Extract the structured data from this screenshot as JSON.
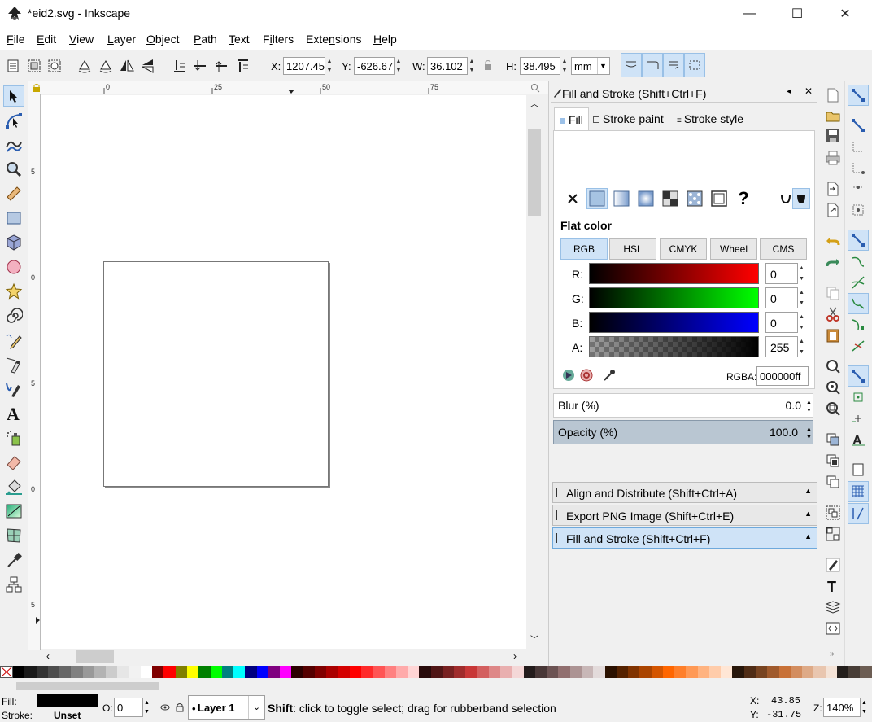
{
  "window": {
    "title": "*eid2.svg - Inkscape",
    "minimize_glyph": "—",
    "maximize_glyph": "☐",
    "close_glyph": "✕"
  },
  "menu": [
    {
      "label": "File",
      "key": "F",
      "rest": "ile"
    },
    {
      "label": "Edit",
      "key": "E",
      "rest": "dit"
    },
    {
      "label": "View",
      "key": "V",
      "rest": "iew"
    },
    {
      "label": "Layer",
      "key": "L",
      "rest": "ayer"
    },
    {
      "label": "Object",
      "key": "O",
      "rest": "bject"
    },
    {
      "label": "Path",
      "key": "P",
      "rest": "ath"
    },
    {
      "label": "Text",
      "key": "T",
      "rest": "ext"
    },
    {
      "label": "Filters",
      "key": "i",
      "pre": "F",
      "rest": "lters"
    },
    {
      "label": "Extensions",
      "key": "n",
      "pre": "Exte",
      "rest": "sions"
    },
    {
      "label": "Help",
      "key": "H",
      "rest": "elp"
    }
  ],
  "tool_controls": {
    "x_label": "X:",
    "x_value": "1207.45",
    "y_label": "Y:",
    "y_value": "-626.67",
    "w_label": "W:",
    "w_value": "36.102",
    "h_label": "H:",
    "h_value": "38.495",
    "unit": "mm"
  },
  "rulers": {
    "top_ticks": [
      "0",
      "25",
      "50",
      "75"
    ],
    "left_ticks": [
      "5",
      "0",
      "5",
      "0",
      "5",
      "0",
      "5"
    ]
  },
  "fill_stroke": {
    "title": "Fill and Stroke (Shift+Ctrl+F)",
    "tabs": {
      "fill": "Fill",
      "stroke_paint": "Stroke paint",
      "stroke_style": "Stroke style"
    },
    "unknown_paint": "?",
    "flat_color_heading": "Flat color",
    "modes": [
      "RGB",
      "HSL",
      "CMYK",
      "Wheel",
      "CMS"
    ],
    "channels": {
      "r_label": "R:",
      "r_value": "0",
      "g_label": "G:",
      "g_value": "0",
      "b_label": "B:",
      "b_value": "0",
      "a_label": "A:",
      "a_value": "255"
    },
    "rgba_label": "RGBA:",
    "rgba_value": "000000ff",
    "blur_label": "Blur (%)",
    "blur_value": "0.0",
    "opacity_label": "Opacity (%)",
    "opacity_value": "100.0"
  },
  "docked_dialogs": [
    "Align and Distribute (Shift+Ctrl+A)",
    "Export PNG Image (Shift+Ctrl+E)",
    "Fill and Stroke (Shift+Ctrl+F)"
  ],
  "palette": [
    "#000000",
    "#1a1a1a",
    "#333333",
    "#4d4d4d",
    "#666666",
    "#808080",
    "#999999",
    "#b3b3b3",
    "#cccccc",
    "#e6e6e6",
    "#f2f2f2",
    "#ffffff",
    "#800000",
    "#ff0000",
    "#808000",
    "#ffff00",
    "#008000",
    "#00ff00",
    "#008080",
    "#00ffff",
    "#000080",
    "#0000ff",
    "#800080",
    "#ff00ff",
    "#2b0000",
    "#550000",
    "#800000",
    "#aa0000",
    "#d40000",
    "#ff0000",
    "#ff2a2a",
    "#ff5555",
    "#ff8080",
    "#ffaaaa",
    "#ffd5d5",
    "#280b0b",
    "#501616",
    "#782121",
    "#a02c2c",
    "#c83737",
    "#d35f5f",
    "#de8787",
    "#e9afaf",
    "#f4d7d7",
    "#241c1c",
    "#483737",
    "#6c5353",
    "#916f6f",
    "#ac9393",
    "#c8b7b7",
    "#e3dbdb",
    "#2b1100",
    "#552200",
    "#803300",
    "#aa4400",
    "#d45500",
    "#ff6600",
    "#ff7f2a",
    "#ff9955",
    "#ffb380",
    "#ffccaa",
    "#ffe6d5",
    "#28170b",
    "#502d16",
    "#784421",
    "#a05a2c",
    "#c87137",
    "#d38d5f",
    "#deaa87",
    "#e9c6af",
    "#f4e3d7",
    "#241f1c",
    "#483e37",
    "#6c5d53"
  ],
  "status": {
    "fill_label": "Fill:",
    "stroke_label": "Stroke:",
    "stroke_value": "Unset",
    "opacity_label": "O:",
    "opacity_value": "0",
    "layer": "Layer 1",
    "hint_key": "Shift",
    "hint_text": ": click to toggle select; drag for rubberband selection",
    "x_label": "X:",
    "x_value": "43.85",
    "y_label": "Y:",
    "y_value": "-31.75",
    "zoom_label": "Z:",
    "zoom_value": "140%"
  }
}
